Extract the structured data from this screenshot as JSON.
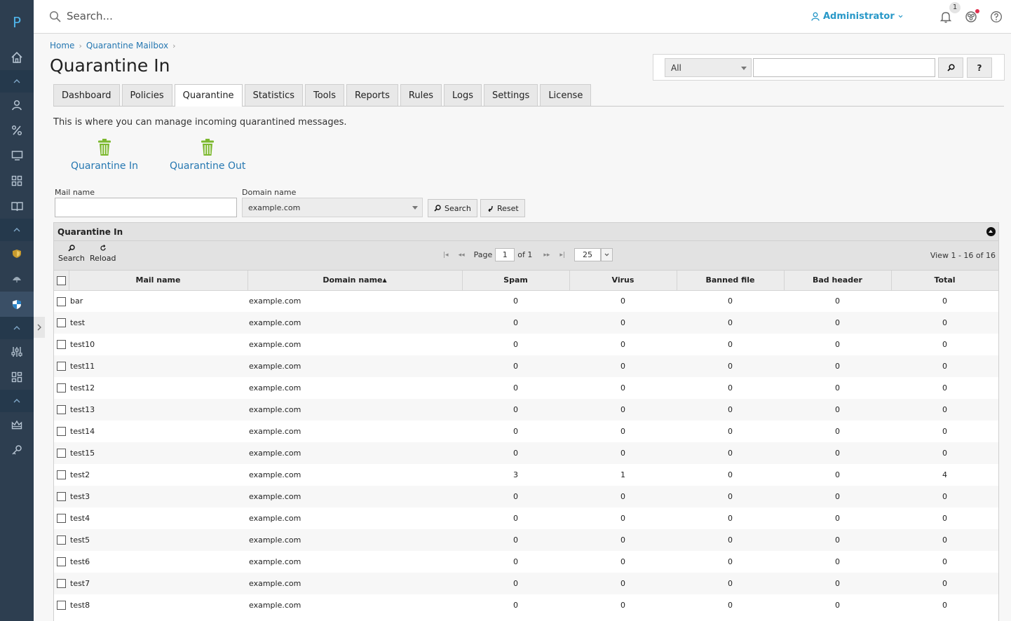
{
  "sidebar": {
    "logo": "P"
  },
  "topbar": {
    "search_placeholder": "Search...",
    "user": "Administrator",
    "notification_count": "1"
  },
  "breadcrumb": {
    "home": "Home",
    "parent": "Quarantine Mailbox"
  },
  "page_title": "Quarantine In",
  "filter": {
    "select_value": "All",
    "help_label": "?"
  },
  "tabs": [
    "Dashboard",
    "Policies",
    "Quarantine",
    "Statistics",
    "Tools",
    "Reports",
    "Rules",
    "Logs",
    "Settings",
    "License"
  ],
  "intro": "This is where you can manage incoming quarantined messages.",
  "quick_links": {
    "in": "Quarantine In",
    "out": "Quarantine Out"
  },
  "form": {
    "mail_label": "Mail name",
    "domain_label": "Domain name",
    "domain_value": "example.com",
    "search_label": "Search",
    "reset_label": "Reset"
  },
  "grid": {
    "title": "Quarantine In",
    "toolbar_search": "Search",
    "toolbar_reload": "Reload",
    "page_label": "Page",
    "page_value": "1",
    "of_label": "of 1",
    "page_size": "25",
    "view_info": "View 1 - 16 of 16",
    "columns": [
      "Mail name",
      "Domain name",
      "Spam",
      "Virus",
      "Banned file",
      "Bad header",
      "Total"
    ],
    "rows": [
      [
        "bar",
        "example.com",
        "0",
        "0",
        "0",
        "0",
        "0"
      ],
      [
        "test",
        "example.com",
        "0",
        "0",
        "0",
        "0",
        "0"
      ],
      [
        "test10",
        "example.com",
        "0",
        "0",
        "0",
        "0",
        "0"
      ],
      [
        "test11",
        "example.com",
        "0",
        "0",
        "0",
        "0",
        "0"
      ],
      [
        "test12",
        "example.com",
        "0",
        "0",
        "0",
        "0",
        "0"
      ],
      [
        "test13",
        "example.com",
        "0",
        "0",
        "0",
        "0",
        "0"
      ],
      [
        "test14",
        "example.com",
        "0",
        "0",
        "0",
        "0",
        "0"
      ],
      [
        "test15",
        "example.com",
        "0",
        "0",
        "0",
        "0",
        "0"
      ],
      [
        "test2",
        "example.com",
        "3",
        "1",
        "0",
        "0",
        "4"
      ],
      [
        "test3",
        "example.com",
        "0",
        "0",
        "0",
        "0",
        "0"
      ],
      [
        "test4",
        "example.com",
        "0",
        "0",
        "0",
        "0",
        "0"
      ],
      [
        "test5",
        "example.com",
        "0",
        "0",
        "0",
        "0",
        "0"
      ],
      [
        "test6",
        "example.com",
        "0",
        "0",
        "0",
        "0",
        "0"
      ],
      [
        "test7",
        "example.com",
        "0",
        "0",
        "0",
        "0",
        "0"
      ],
      [
        "test8",
        "example.com",
        "0",
        "0",
        "0",
        "0",
        "0"
      ]
    ]
  },
  "colors": {
    "sidebar": "#2d3e50",
    "link": "#2577b1",
    "accent": "#2898c8",
    "trash": "#7cb82f"
  }
}
